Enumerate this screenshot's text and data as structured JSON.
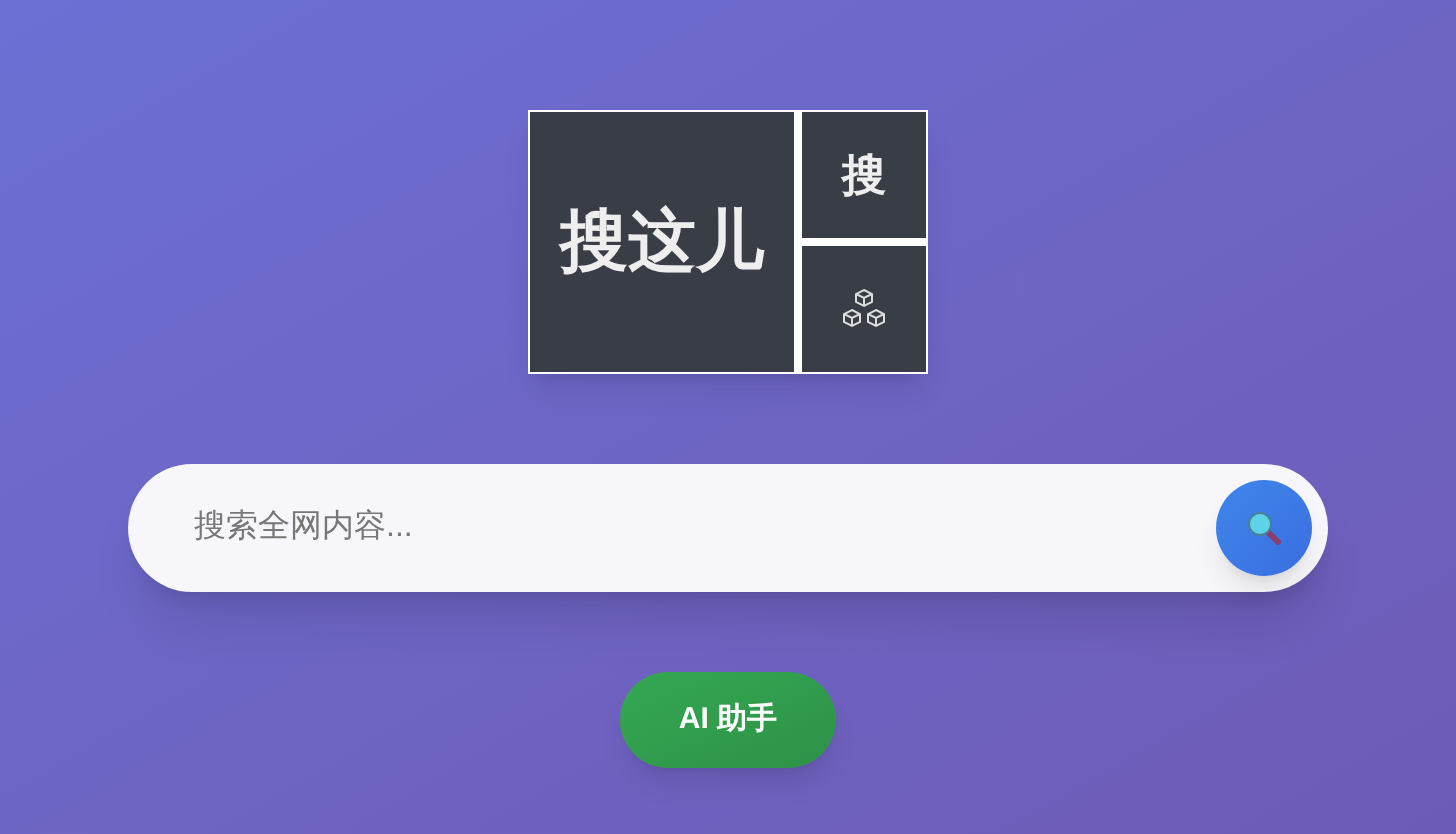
{
  "logo": {
    "main_text": "搜这儿",
    "side_text": "搜"
  },
  "search": {
    "placeholder": "搜索全网内容..."
  },
  "ai_button": {
    "label": "AI 助手"
  }
}
